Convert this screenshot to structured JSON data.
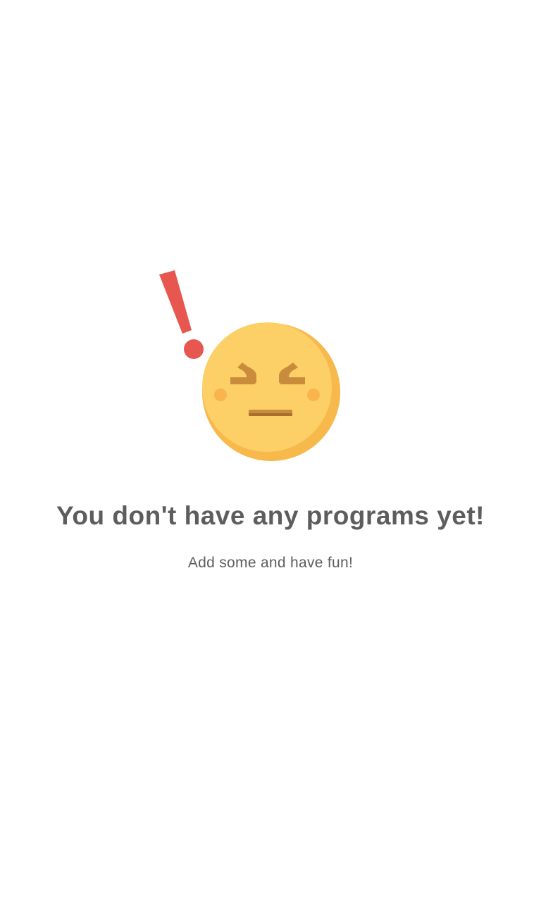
{
  "empty_state": {
    "title": "You don't have any programs yet!",
    "subtitle": "Add some and have fun!",
    "illustration": {
      "icon": "frustrated-face-emoji-icon",
      "exclamation_icon": "exclamation-mark-icon"
    }
  },
  "colors": {
    "background": "#ffffff",
    "text": "#5d5d5d",
    "face": "#fdcf67",
    "face_shadow": "#f8b94c",
    "cheeks": "#f9b44e",
    "features": "#c98b3c",
    "exclamation": "#e8574f"
  }
}
